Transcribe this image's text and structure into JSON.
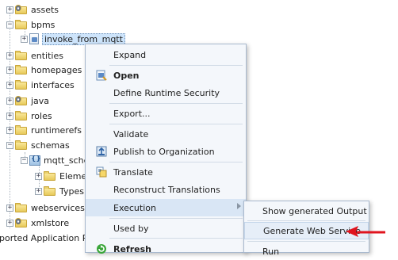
{
  "tree": {
    "assets": "assets",
    "bpms": "bpms",
    "invoke": "invoke_from_mqtt",
    "entities": "entities",
    "homepages": "homepages",
    "interfaces": "interfaces",
    "java": "java",
    "roles": "roles",
    "runtimerefs": "runtimerefs",
    "schemas": "schemas",
    "mqtt_schema": "mqtt_sche",
    "elements": "Eleme",
    "types": "Types",
    "webservices": "webservices",
    "xmlstore": "xmlstore",
    "supported": "ported Application Pack"
  },
  "expander": {
    "plus": "+",
    "minus": "−"
  },
  "menu": {
    "expand": "Expand",
    "open": "Open",
    "define_security": "Define Runtime Security",
    "export": "Export...",
    "validate": "Validate",
    "publish": "Publish to Organization",
    "translate": "Translate",
    "reconstruct": "Reconstruct Translations",
    "execution": "Execution",
    "used_by": "Used by",
    "refresh": "Refresh"
  },
  "submenu": {
    "show_output": "Show generated Output",
    "generate_ws": "Generate Web Service",
    "run": "Run"
  },
  "colors": {
    "arrow": "#e0141e",
    "highlight": "#d9e6f5"
  }
}
